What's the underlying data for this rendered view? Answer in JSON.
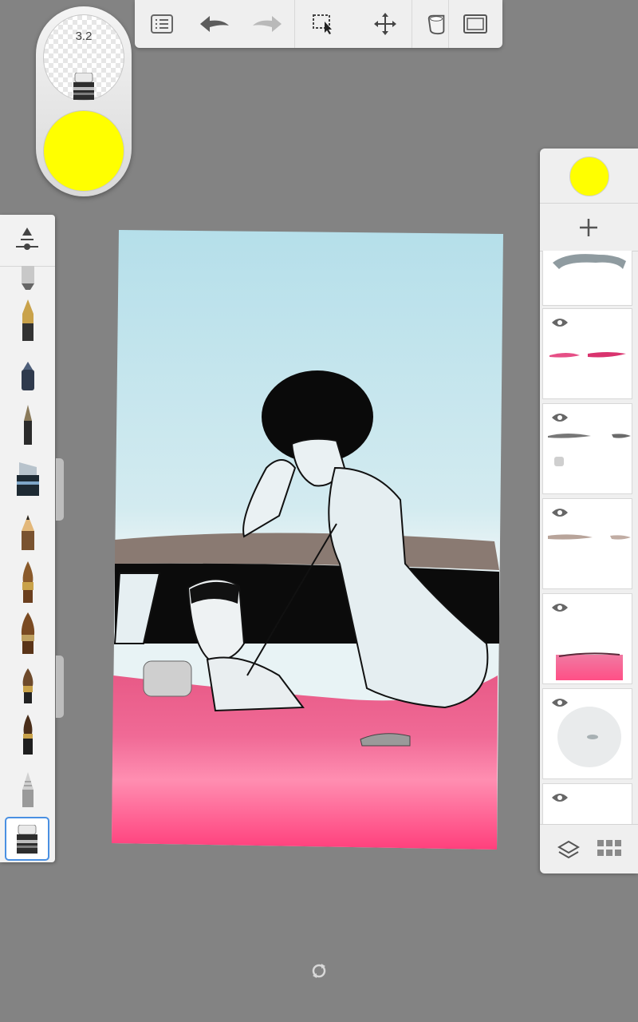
{
  "brush_puck": {
    "size_value": "3.2",
    "current_tool": "eraser-icon",
    "current_color": "#ffff00"
  },
  "toolbar": {
    "buttons": [
      "list-icon",
      "undo-icon",
      "redo-icon",
      "selection-icon",
      "transform-icon",
      "fill-icon",
      "canvas-icon"
    ]
  },
  "brush_palette": {
    "header_icon": "brush-settings-icon",
    "brushes": [
      "airbrush-icon",
      "fountain-pen-icon",
      "marker-pen-icon",
      "ballpoint-pen-icon",
      "chisel-marker-icon",
      "pencil-icon",
      "round-brush-icon",
      "flat-brush-icon",
      "paint-brush-icon",
      "ink-brush-icon",
      "smudge-icon",
      "eraser-icon"
    ],
    "selected": "eraser-icon"
  },
  "layers_panel": {
    "current_color": "#ffff00",
    "add_icon": "add-icon",
    "layer_count_visible": 7,
    "footer_icons": [
      "layers-icon",
      "grid-icon"
    ]
  },
  "colors": {
    "background": "#838383",
    "sky_top": "#b5dfea",
    "car_pink": "#ff4f86"
  },
  "bottom": {
    "icon": "rotate-icon"
  }
}
